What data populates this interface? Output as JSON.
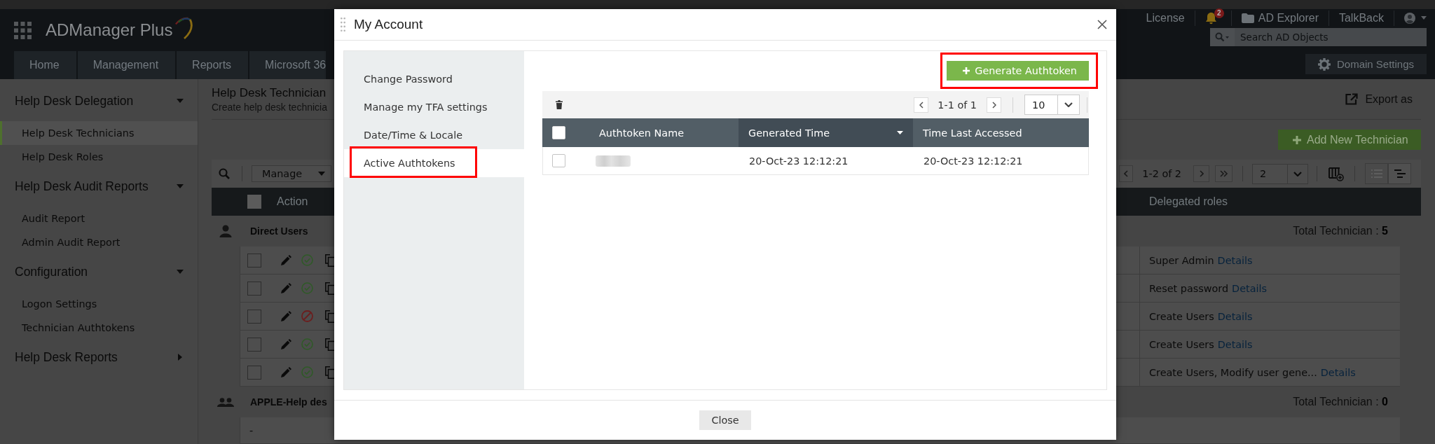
{
  "app": {
    "logo": "ADManager Plus",
    "nav_tabs": [
      {
        "label": "Home",
        "selected": false
      },
      {
        "label": "Management",
        "selected": false
      },
      {
        "label": "Reports",
        "selected": false
      },
      {
        "label": "Microsoft 36",
        "selected": false
      }
    ],
    "top_links": [
      {
        "kind": "text",
        "label": "License"
      },
      {
        "kind": "bell",
        "badge": "2"
      },
      {
        "kind": "folder",
        "label": "AD Explorer"
      },
      {
        "kind": "text",
        "label": "TalkBack"
      },
      {
        "kind": "user"
      }
    ],
    "search": {
      "placeholder": "Search AD Objects"
    },
    "domain_settings": "Domain Settings"
  },
  "sidebar": {
    "groups": [
      {
        "title": "Help Desk Delegation",
        "expanded": true,
        "items": [
          {
            "label": "Help Desk Technicians",
            "selected": true
          },
          {
            "label": "Help Desk Roles",
            "selected": false
          }
        ]
      },
      {
        "title": "Help Desk Audit Reports",
        "expanded": true,
        "items": [
          {
            "label": "Audit Report",
            "selected": false
          },
          {
            "label": "Admin Audit Report",
            "selected": false
          }
        ]
      },
      {
        "title": "Configuration",
        "expanded": true,
        "items": [
          {
            "label": "Logon Settings",
            "selected": false
          },
          {
            "label": "Technician Authtokens",
            "selected": false
          }
        ]
      },
      {
        "title": "Help Desk Reports",
        "expanded": false
      }
    ]
  },
  "page": {
    "title": "Help Desk Technician",
    "subtitle": "Create help desk technicia",
    "export": "Export as",
    "add_button": "Add New Technician",
    "toolbar": {
      "manage": "Manage",
      "range": "1-2 of 2",
      "page_size": "2",
      "view_modes": [
        {
          "kind": "list",
          "selected": false
        },
        {
          "kind": "hierarchy",
          "selected": true
        }
      ]
    },
    "table": {
      "header_checked": false,
      "columns": [
        "Action",
        "Delegated roles"
      ],
      "groups": [
        {
          "kind": "user",
          "name": "Direct Users",
          "total": "Total Technician : **5**",
          "rows": [
            {
              "checked": false,
              "active": true,
              "role": "Super Admin",
              "link": "Details"
            },
            {
              "checked": false,
              "active": true,
              "role": "Reset password",
              "link": "Details"
            },
            {
              "checked": false,
              "active": false,
              "role": "Create Users",
              "link": "Details"
            },
            {
              "checked": false,
              "active": true,
              "role": "Create Users",
              "link": "Details"
            },
            {
              "checked": false,
              "active": true,
              "role": "Create Users, Modify user gene...",
              "link": "Details"
            }
          ]
        },
        {
          "kind": "group",
          "name": "APPLE-Help des",
          "total": "Total Technician : **0**",
          "empty": "-"
        }
      ]
    }
  },
  "modal": {
    "title": "My Account",
    "menu": [
      {
        "label": "Change Password",
        "selected": false,
        "highlighted": false
      },
      {
        "label": "Manage my TFA settings",
        "selected": false,
        "highlighted": false
      },
      {
        "label": "Date/Time & Locale",
        "selected": false,
        "highlighted": false
      },
      {
        "label": "Active Authtokens",
        "selected": true,
        "highlighted": true
      }
    ],
    "generate_button": {
      "label": "Generate Authtoken",
      "highlighted": true
    },
    "pager": {
      "range": "1-1 of 1",
      "page_size": "10"
    },
    "table": {
      "header_checked": false,
      "columns": [
        {
          "label": "Authtoken Name",
          "sorted": false
        },
        {
          "label": "Generated Time",
          "sorted": true
        },
        {
          "label": "Time Last Accessed",
          "sorted": false
        }
      ],
      "rows": [
        {
          "checked": false,
          "name_blurred": true,
          "generated": "20-Oct-23 12:12:21",
          "last_accessed": "20-Oct-23 12:12:21"
        }
      ]
    },
    "close_button": "Close"
  }
}
